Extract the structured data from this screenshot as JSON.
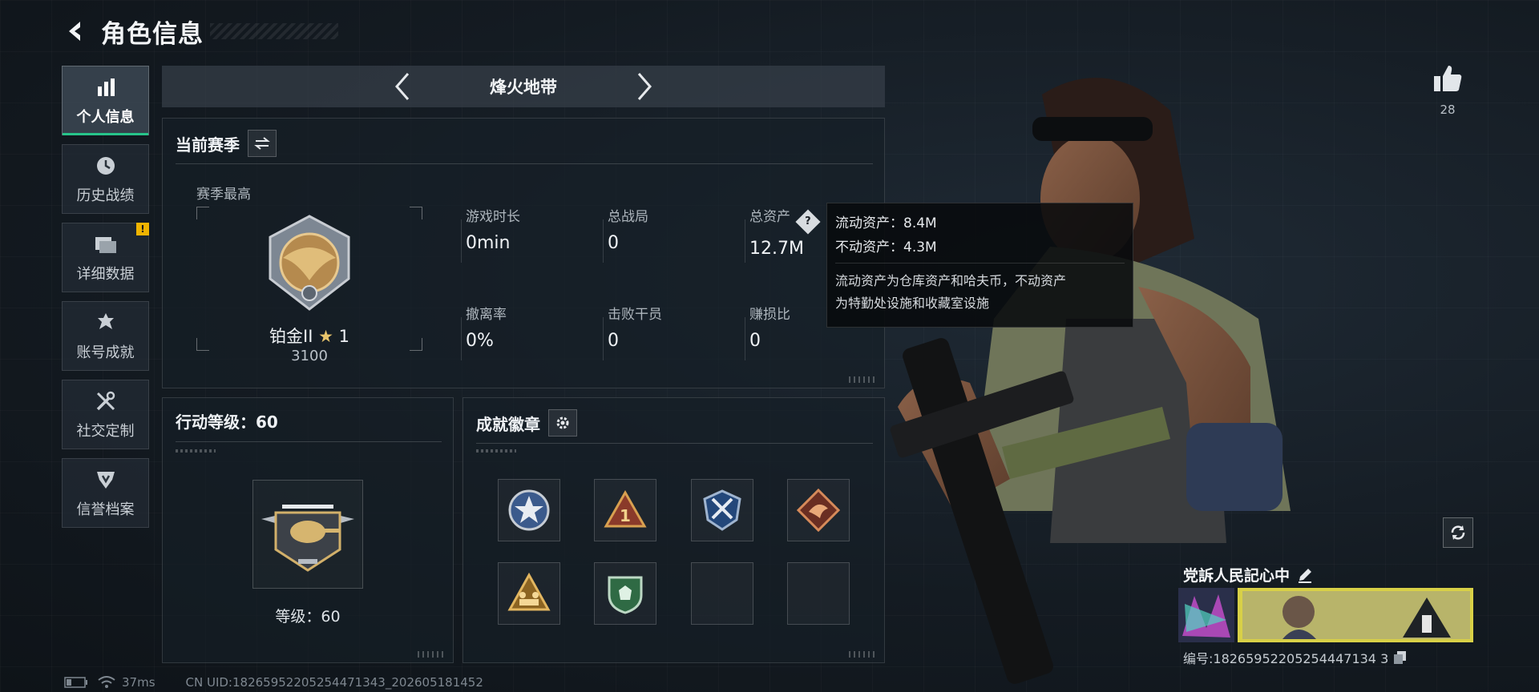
{
  "header": {
    "title": "角色信息"
  },
  "sidebar": {
    "items": [
      {
        "label": "个人信息",
        "icon": "bar-chart-icon",
        "active": true
      },
      {
        "label": "历史战绩",
        "icon": "clock-icon"
      },
      {
        "label": "详细数据",
        "icon": "folders-icon",
        "badge": "!"
      },
      {
        "label": "账号成就",
        "icon": "trophy-icon"
      },
      {
        "label": "社交定制",
        "icon": "tools-icon"
      },
      {
        "label": "信誉档案",
        "icon": "shield-badge-icon"
      }
    ]
  },
  "mode": {
    "title": "烽火地带"
  },
  "season": {
    "title": "当前赛季",
    "best_label": "赛季最高",
    "rank_name": "铂金II",
    "rank_stars": "1",
    "rank_score": "3100",
    "stats": [
      {
        "key": "游戏时长",
        "value": "0min"
      },
      {
        "key": "总战局",
        "value": "0"
      },
      {
        "key": "总资产",
        "value": "12.7M"
      },
      {
        "key": "撤离率",
        "value": "0%"
      },
      {
        "key": "击败干员",
        "value": "0"
      },
      {
        "key": "赚损比",
        "value": "0"
      }
    ]
  },
  "tooltip": {
    "liquid": "流动资产：8.4M",
    "fixed": "不动资产：4.3M",
    "desc_line1": "流动资产为仓库资产和哈夫币，不动资产",
    "desc_line2": "为特勤处设施和收藏室设施"
  },
  "action_level": {
    "title": "行动等级：60",
    "level_label": "等级：60"
  },
  "achievements": {
    "title": "成就徽章",
    "badges": [
      "star-emblem-icon",
      "rank-one-triangle-icon",
      "crossed-blades-emblem-icon",
      "dragon-diamond-icon",
      "squad-triangle-icon",
      "green-shield-icon",
      "",
      ""
    ]
  },
  "profile": {
    "likes": "28",
    "player_name": "党訴人民記心中",
    "player_id": "编号:1826595220525444713 43",
    "player_id_full": "编号:18265952205254447134 3"
  },
  "status": {
    "ping": "37ms",
    "uid": "CN UID:18265952205254471343_202605181452"
  },
  "colors": {
    "accent": "#27c48a",
    "warning": "#f0b400",
    "panel_bg": "#161e26"
  }
}
